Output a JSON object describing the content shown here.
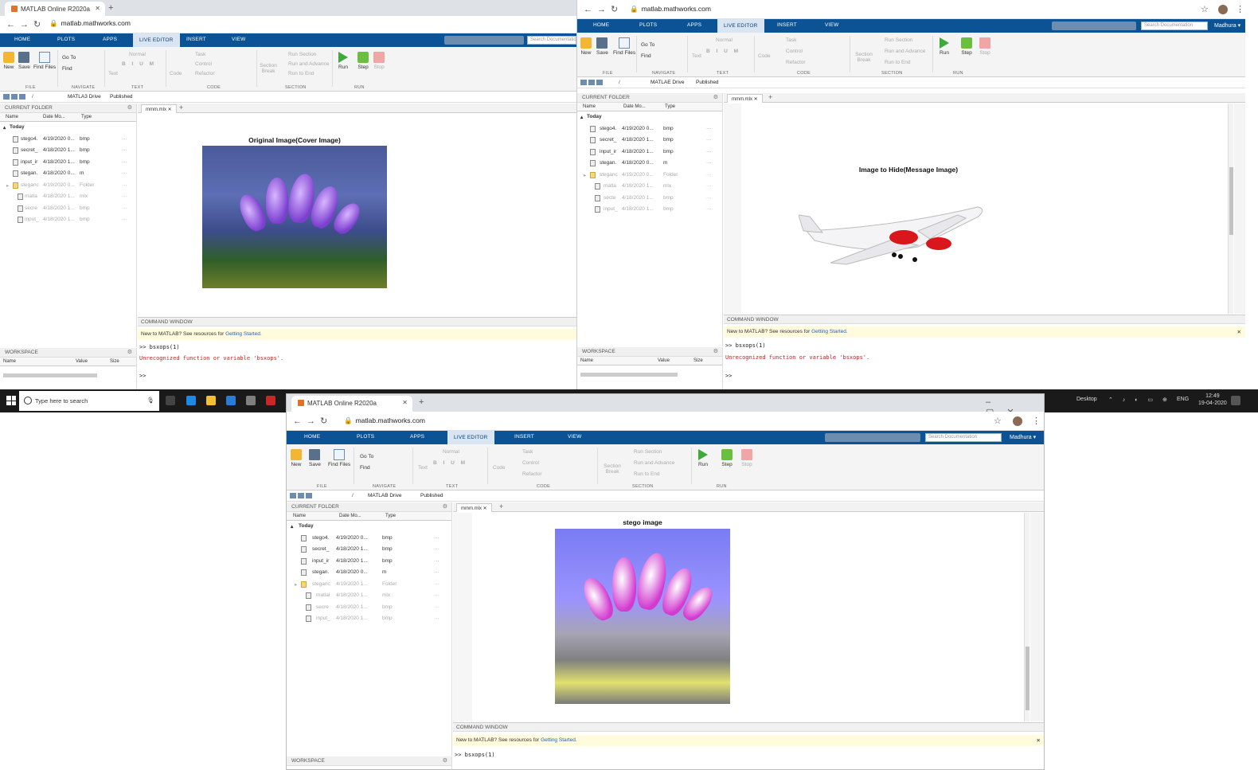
{
  "browser": {
    "tab_title": "MATLAB Online R2020a",
    "tab_title_short": "MATLAB Online R2020a",
    "url": "matlab.mathworks.com"
  },
  "matlab": {
    "menu": [
      "HOME",
      "PLOTS",
      "APPS",
      "LIVE EDITOR",
      "INSERT",
      "VIEW"
    ],
    "search_placeholder": "Search Documentation",
    "user": "Madhura",
    "ribbon": {
      "new": "New",
      "save": "Save",
      "find_files": "Find Files",
      "go_to": "Go To",
      "find": "Find",
      "text": "Text",
      "normal": "Normal",
      "code": "Code",
      "task": "Task",
      "control": "Control",
      "refactor": "Refactor",
      "section_break": "Section Break",
      "run_section": "Run Section",
      "run_and_advance": "Run and Advance",
      "run_to_end": "Run to End",
      "run": "Run",
      "step": "Step",
      "stop": "Stop",
      "groups": {
        "file": "FILE",
        "navigate": "NAVIGATE",
        "text": "TEXT",
        "code": "CODE",
        "section": "SECTION",
        "run": "RUN"
      }
    },
    "path": {
      "drive": "MATLAB Drive",
      "drive_a": "MATLA3 Drive",
      "drive_b": "MATLAE Drive",
      "folder": "Published"
    },
    "current_folder": {
      "title": "CURRENT FOLDER",
      "columns": [
        "Name",
        "Date Mo...",
        "Type"
      ],
      "group": "Today"
    },
    "doc_tab": "mmm.mlx",
    "command_window": {
      "title": "COMMAND WINDOW",
      "banner_prefix": "New to MATLAB? See resources for ",
      "banner_link": "Getting Started",
      "banner_suffix": ".",
      "command": ">> bsxops(1)",
      "error": "Unrecognized function or variable 'bsxops'.",
      "prompt": ">>"
    },
    "workspace": {
      "title": "WORKSPACE",
      "columns": [
        "Name",
        "Value",
        "Size"
      ]
    }
  },
  "windows": {
    "w1": {
      "files": [
        {
          "name": "stego4.",
          "date": "4/19/2020 0...",
          "type": "bmp"
        },
        {
          "name": "secret_",
          "date": "4/18/2020 1...",
          "type": "bmp"
        },
        {
          "name": "input_ir",
          "date": "4/18/2020 1...",
          "type": "bmp"
        },
        {
          "name": "stegan.",
          "date": "4/18/2020 0...",
          "type": "m"
        },
        {
          "name": "steganc",
          "date": "4/19/2020 0...",
          "type": "Folder"
        },
        {
          "name": "matla",
          "date": "4/18/2020 1...",
          "type": "mlx"
        },
        {
          "name": "secre",
          "date": "4/18/2020 1...",
          "type": "bmp"
        },
        {
          "name": "input_",
          "date": "4/18/2020 1...",
          "type": "bmp"
        }
      ],
      "figure_title": "Original Image(Cover Image)"
    },
    "w2": {
      "files": [
        {
          "name": "stego4.",
          "date": "4/19/2020 0...",
          "type": "bmp"
        },
        {
          "name": "secret_",
          "date": "4/18/2020 1...",
          "type": "bmp"
        },
        {
          "name": "input_ir",
          "date": "4/18/2020 1...",
          "type": "bmp"
        },
        {
          "name": "stegan.",
          "date": "4/18/2020 0...",
          "type": "m"
        },
        {
          "name": "steganc",
          "date": "4/19/2020 0...",
          "type": "Folder"
        },
        {
          "name": "matla",
          "date": "4/18/2020 1...",
          "type": "mlx"
        },
        {
          "name": "secte",
          "date": "4/18/2020 1...",
          "type": "bmp"
        },
        {
          "name": "input_",
          "date": "4/18/2020 1...",
          "type": "bmp"
        }
      ],
      "figure_title": "Image to Hide(Message Image)"
    },
    "w3": {
      "files": [
        {
          "name": "stego4.",
          "date": "4/19/2020 0...",
          "type": "bmp"
        },
        {
          "name": "secret_",
          "date": "4/18/2020 1...",
          "type": "bmp"
        },
        {
          "name": "input_ir",
          "date": "4/18/2020 1...",
          "type": "bmp"
        },
        {
          "name": "stegan.",
          "date": "4/18/2020 0...",
          "type": "m"
        },
        {
          "name": "steganc",
          "date": "4/19/2020 1...",
          "type": "Folder"
        },
        {
          "name": "matlal",
          "date": "4/18/2020 1...",
          "type": "mlx"
        },
        {
          "name": "secre",
          "date": "4/18/2020 1...",
          "type": "bmp"
        },
        {
          "name": "input_",
          "date": "4/18/2020 1...",
          "type": "bmp"
        }
      ],
      "figure_title": "stego image"
    }
  },
  "taskbar": {
    "search_placeholder": "Type here to search",
    "desktop": "Desktop",
    "lang": "ENG",
    "time": "12:49",
    "date": "19-04-2020"
  }
}
